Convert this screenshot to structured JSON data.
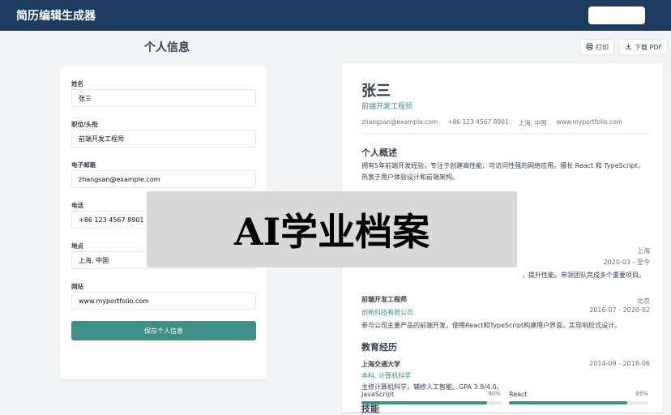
{
  "app": {
    "title": "简历编辑生成器"
  },
  "form": {
    "heading": "个人信息",
    "fields": [
      {
        "label": "姓名",
        "value": "张三"
      },
      {
        "label": "职位/头衔",
        "value": "前端开发工程师"
      },
      {
        "label": "电子邮箱",
        "value": "zhangsan@example.com"
      },
      {
        "label": "电话",
        "value": "+86 123 4567 8901"
      },
      {
        "label": "地点",
        "value": "上海, 中国"
      },
      {
        "label": "网站",
        "value": "www.myportfolio.com"
      }
    ],
    "save_label": "保存个人信息"
  },
  "toolbar": {
    "print_label": "打印",
    "download_label": "下载 PDF"
  },
  "resume": {
    "name": "张三",
    "title": "前端开发工程师",
    "contact": [
      "zhangsan@example.com",
      "+86 123 4567 8901",
      "上海, 中国",
      "www.myportfolio.com"
    ],
    "summary_heading": "个人概述",
    "summary_text": "拥有5年前端开发经验，专注于创建高性能、可访问性强的网络应用。擅长 React 和 TypeScript，热衷于用户体验设计和前端架构。",
    "job1": {
      "location": "上海",
      "dates": "2020-03 - 至今",
      "desc_partial": "，提升性能。带领团队完成多个重要项目。"
    },
    "job2": {
      "role": "前端开发工程师",
      "company": "创新科技有限公司",
      "location": "北京",
      "dates": "2016-07 - 2020-02",
      "desc": "参与公司主要产品的前端开发，使用React和TypeScript构建用户界面，实现响应式设计。"
    },
    "education_heading": "教育经历",
    "edu": {
      "school": "上海交通大学",
      "degree": "本科, 计算机科学",
      "dates": "2014-09 - 2018-06",
      "desc": "主修计算机科学，辅修人工智能。GPA 3.8/4.0。"
    },
    "skills_heading": "技能",
    "skills": [
      {
        "name": "JavaScript",
        "percent_label": "90%",
        "level": 0.9
      },
      {
        "name": "React",
        "percent_label": "85%",
        "level": 0.85
      }
    ]
  },
  "overlay": {
    "text": "AI学业档案"
  },
  "colors": {
    "header": "#1e3a5f",
    "accent": "#3f8f86"
  },
  "icons": {
    "print": "printer-icon",
    "download": "download-icon"
  }
}
